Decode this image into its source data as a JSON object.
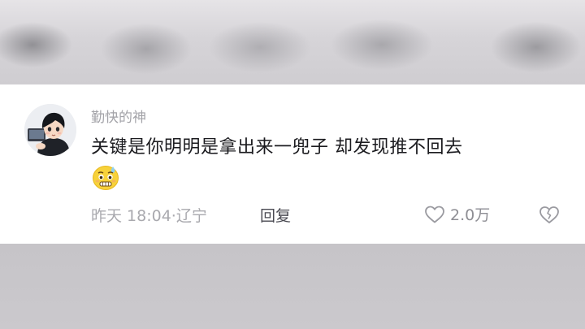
{
  "comment": {
    "username": "勤快的神",
    "text": "关键是你明明是拿出来一兜子 却发现推不回去",
    "emoji": "sweating-pleading-face",
    "time": "昨天 18:04",
    "separator": "·",
    "location": "辽宁",
    "reply_label": "回复",
    "like_count": "2.0万",
    "like_icon": "heart-outline-icon",
    "dislike_icon": "broken-heart-icon"
  },
  "colors": {
    "card_background": "#ffffff",
    "backdrop": "#c9c7cb",
    "username": "#a3a3a8",
    "comment_text": "#1b1b1f",
    "meta_text": "#a9a9ae",
    "reply_text": "#4a4a52"
  }
}
